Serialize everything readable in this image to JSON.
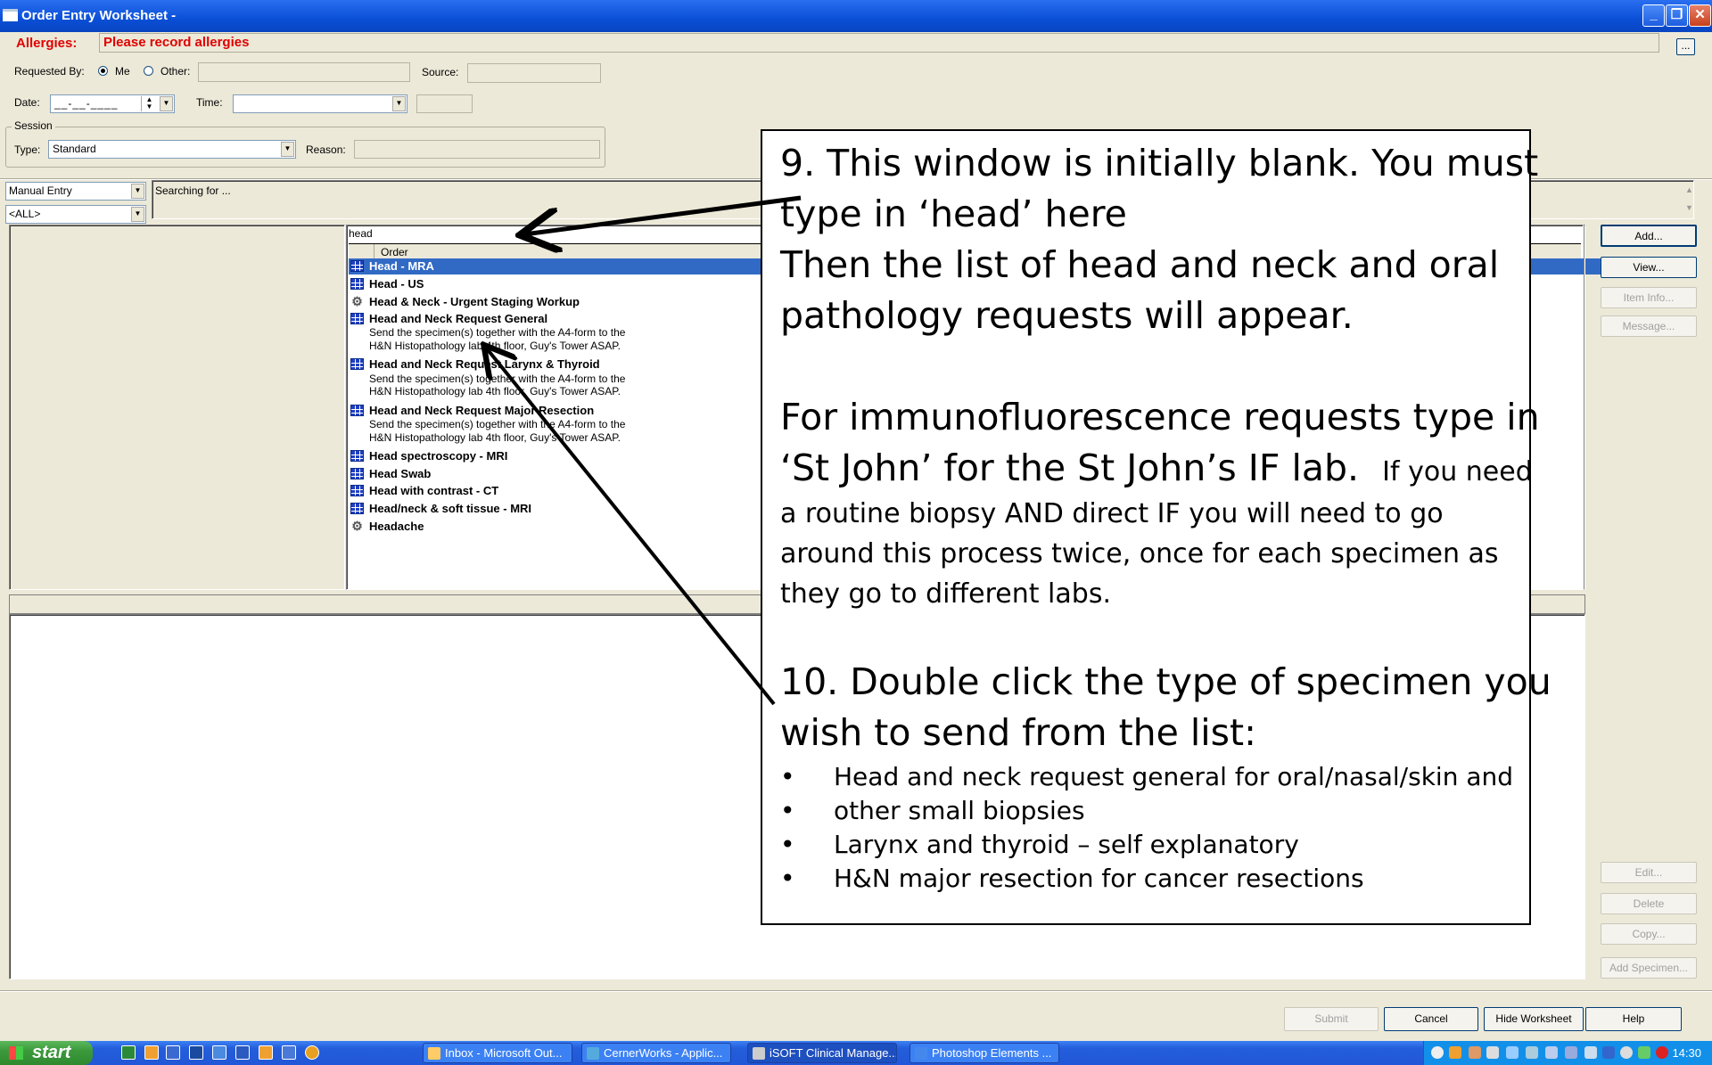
{
  "window": {
    "title": "Order Entry Worksheet -"
  },
  "allergies": {
    "label": "Allergies:",
    "value": "Please record allergies",
    "more_button": "..."
  },
  "requested_by": {
    "label": "Requested By:",
    "me": "Me",
    "other": "Other:",
    "selected": "Me",
    "other_value": ""
  },
  "source": {
    "label": "Source:",
    "value": ""
  },
  "date": {
    "label": "Date:",
    "value": "__-__-____"
  },
  "time": {
    "label": "Time:",
    "value": ""
  },
  "session": {
    "legend": "Session",
    "type_label": "Type:",
    "type_value": "Standard",
    "reason_label": "Reason:",
    "reason_value": ""
  },
  "search": {
    "mode": "Manual Entry",
    "filter": "<ALL>",
    "status": "Searching for ...",
    "query": "head",
    "column_header": "Order"
  },
  "orders": [
    {
      "label": "Head - MRA",
      "icon": "grid-icon",
      "selected": true
    },
    {
      "label": "Head - US",
      "icon": "grid-icon"
    },
    {
      "label": "Head & Neck - Urgent Staging Workup",
      "icon": "gear-icon"
    },
    {
      "label": "Head and Neck Request General",
      "icon": "grid-icon",
      "note": [
        "Send the specimen(s) together with the A4-form to the",
        "H&N Histopathology lab 4th floor, Guy's Tower ASAP."
      ]
    },
    {
      "label": "Head and Neck Request Larynx & Thyroid",
      "icon": "grid-icon",
      "note": [
        "Send the specimen(s) together with the A4-form to the",
        "H&N Histopathology lab 4th floor, Guy's Tower ASAP."
      ]
    },
    {
      "label": "Head and Neck Request Major Resection",
      "icon": "grid-icon",
      "note": [
        "Send the specimen(s) together with the A4-form to the",
        "H&N Histopathology lab 4th floor, Guy's Tower ASAP."
      ]
    },
    {
      "label": "Head spectroscopy - MRI",
      "icon": "grid-icon"
    },
    {
      "label": "Head Swab",
      "icon": "grid-icon"
    },
    {
      "label": "Head with contrast - CT",
      "icon": "grid-icon"
    },
    {
      "label": "Head/neck & soft tissue - MRI",
      "icon": "grid-icon"
    },
    {
      "label": "Headache",
      "icon": "gear-icon"
    }
  ],
  "side_buttons": {
    "add": "Add...",
    "view": "View...",
    "item_info": "Item Info...",
    "message": "Message...",
    "edit": "Edit...",
    "delete": "Delete",
    "copy": "Copy...",
    "add_specimen": "Add Specimen..."
  },
  "footer_buttons": {
    "submit": "Submit",
    "cancel": "Cancel",
    "hide_worksheet": "Hide Worksheet",
    "help": "Help"
  },
  "instructions": {
    "step9_line1": "9. This window is initially blank.  You must",
    "step9_line2": "type in ‘head’ here",
    "step9_line3": "Then the list of head and neck and oral",
    "step9_line4": "pathology requests will appear.",
    "if_line1": "For immunofluorescence requests type in",
    "if_line2a": "‘St John’ for the St John’s IF lab.  ",
    "if_line2b": "If you need",
    "if_line3": "a routine biopsy AND direct IF you will need to go",
    "if_line4": "around this process twice, once for each specimen as",
    "if_line5": "they go to different labs.",
    "step10_line1": "10. Double click the type of specimen you",
    "step10_line2": "wish to send from the list:",
    "bullets": [
      "Head and neck request general for oral/nasal/skin and",
      "other small biopsies",
      "Larynx and thyroid – self explanatory",
      "H&N major resection for cancer resections"
    ]
  },
  "taskbar": {
    "start": "start",
    "tasks": [
      "Inbox - Microsoft Out...",
      "CernerWorks - Applic...",
      "iSOFT Clinical Manage...",
      "Photoshop Elements ..."
    ],
    "clock": "14:30"
  }
}
